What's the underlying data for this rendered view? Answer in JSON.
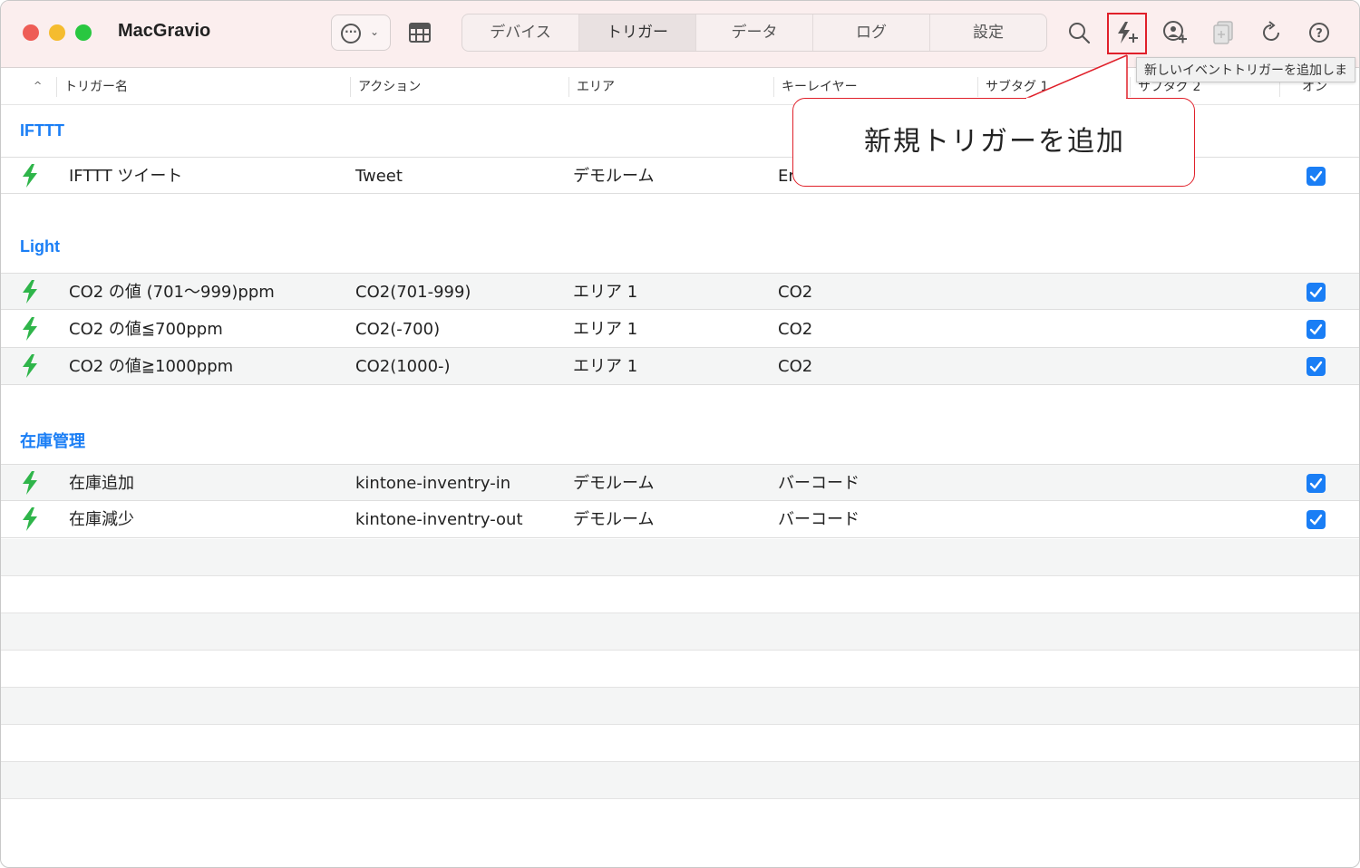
{
  "app": {
    "title": "MacGravio"
  },
  "toolbar": {
    "tabs": [
      "デバイス",
      "トリガー",
      "データ",
      "ログ",
      "設定"
    ],
    "active_tab": "トリガー",
    "icons": [
      "ellipsis-menu-icon",
      "layout-icon",
      "search-icon",
      "add-trigger-icon",
      "add-location-icon",
      "copy-icon",
      "reload-icon",
      "help-icon"
    ],
    "tooltip": "新しいイベントトリガーを追加しま"
  },
  "table": {
    "headers": {
      "name": "トリガー名",
      "action": "アクション",
      "area": "エリア",
      "key_layer": "キーレイヤー",
      "subtag1": "サブタグ 1",
      "subtag2": "サブタグ 2",
      "on": "オン"
    },
    "groups": [
      {
        "title": "IFTTT",
        "rows": [
          {
            "name": "IFTTT ツイート",
            "action": "Tweet",
            "area": "デモルーム",
            "layer": "Er",
            "on": true
          }
        ]
      },
      {
        "title": "Light",
        "rows": [
          {
            "name": "CO2 の値 (701〜999)ppm",
            "action": "CO2(701-999)",
            "area": "エリア 1",
            "layer": "CO2",
            "on": true
          },
          {
            "name": "CO2 の値≦700ppm",
            "action": "CO2(-700)",
            "area": "エリア 1",
            "layer": "CO2",
            "on": true
          },
          {
            "name": "CO2 の値≧1000ppm",
            "action": "CO2(1000-)",
            "area": "エリア 1",
            "layer": "CO2",
            "on": true
          }
        ]
      },
      {
        "title": "在庫管理",
        "rows": [
          {
            "name": "在庫追加",
            "action": "kintone-inventry-in",
            "area": "デモルーム",
            "layer": "バーコード",
            "on": true
          },
          {
            "name": "在庫減少",
            "action": "kintone-inventry-out",
            "area": "デモルーム",
            "layer": "バーコード",
            "on": true
          }
        ]
      }
    ]
  },
  "callout": {
    "text": "新規トリガーを追加"
  },
  "colors": {
    "accent": "#1a7ef5",
    "bolt": "#2fb54a",
    "highlight": "#e0202a",
    "toolbar_bg": "#fbeeee"
  }
}
